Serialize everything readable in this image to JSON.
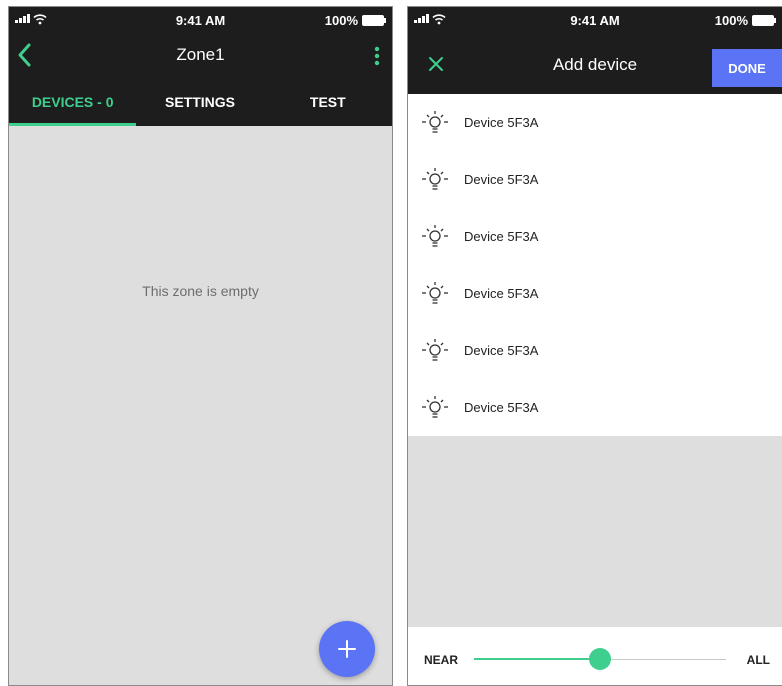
{
  "colors": {
    "accent": "#3ecf8e",
    "primary": "#5a74f5",
    "dark": "#1d1d1d",
    "empty_bg": "#dedede"
  },
  "left": {
    "status": {
      "time": "9:41 AM",
      "battery": "100%"
    },
    "title": "Zone1",
    "back_icon": "chevron-left-icon",
    "more_icon": "more-vertical-icon",
    "tabs": [
      {
        "label": "DEVICES - 0",
        "active": true
      },
      {
        "label": "SETTINGS",
        "active": false
      },
      {
        "label": "TEST",
        "active": false
      }
    ],
    "empty_message": "This zone is empty",
    "fab_icon": "plus-icon"
  },
  "right": {
    "status": {
      "time": "9:41 AM",
      "battery": "100%"
    },
    "title": "Add device",
    "close_icon": "close-icon",
    "done_label": "DONE",
    "devices": [
      {
        "label": "Device  5F3A",
        "icon": "lightbulb-icon"
      },
      {
        "label": "Device  5F3A",
        "icon": "lightbulb-icon"
      },
      {
        "label": "Device  5F3A",
        "icon": "lightbulb-icon"
      },
      {
        "label": "Device  5F3A",
        "icon": "lightbulb-icon"
      },
      {
        "label": "Device  5F3A",
        "icon": "lightbulb-icon"
      },
      {
        "label": "Device  5F3A",
        "icon": "lightbulb-icon"
      }
    ],
    "range": {
      "min_label": "NEAR",
      "max_label": "ALL",
      "value": 0.5
    }
  }
}
